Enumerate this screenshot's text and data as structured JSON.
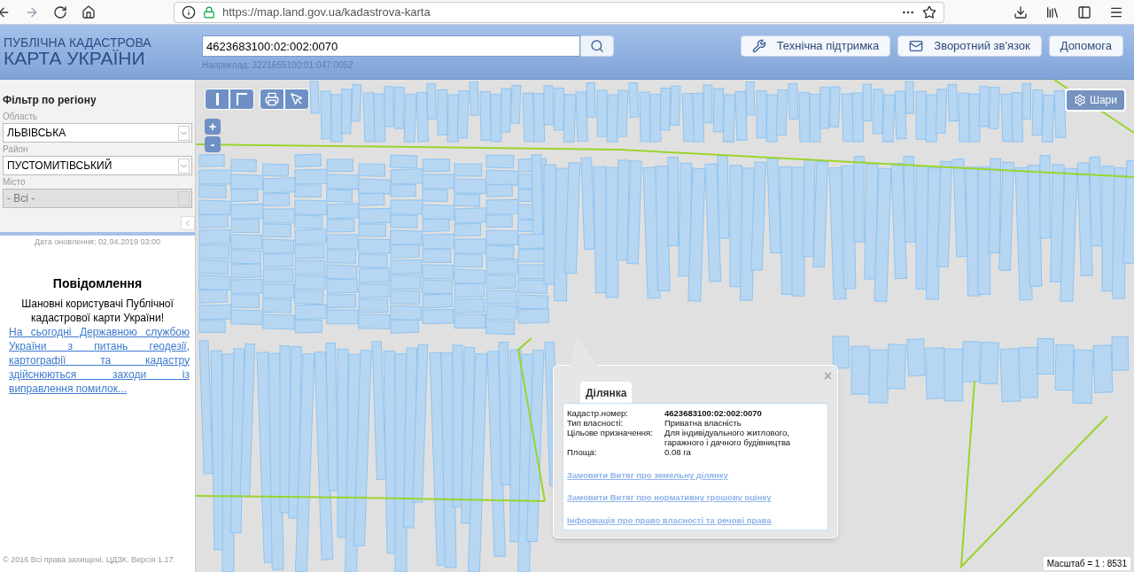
{
  "browser": {
    "url": "https://map.land.gov.ua/kadastrova-karta"
  },
  "header": {
    "logo": [
      "ПУБЛІЧНА КАДАСТРОВА",
      "КАРТА УКРАЇНИ"
    ],
    "search": {
      "value": "4623683100:02:002:0070",
      "hint": "Наприклад: 3221655100:01:047:0052"
    },
    "buttons": [
      {
        "label": "Технічна підтримка",
        "kind": "support"
      },
      {
        "label": "Зворотний зв'язок",
        "kind": "mail"
      },
      {
        "label": "Допомога",
        "kind": "plain"
      }
    ]
  },
  "sidebar": {
    "title": "Фільтр по регіону",
    "filters": [
      {
        "label": "Область",
        "value": "ЛЬВІВСЬКА",
        "disabled": false
      },
      {
        "label": "Район",
        "value": "ПУСТОМИТІВСЬКИЙ",
        "disabled": false
      },
      {
        "label": "Місто",
        "value": "- Всі -",
        "disabled": true
      }
    ],
    "updated": "Дата оновлення: 02.04.2019 03:00",
    "notice": {
      "title": "Повідомлення",
      "greeting": "Шановні користувачі Публічної кадастрової карти України!",
      "link": "На сьогодні Державною службою України з питань геодезії, картографії та кадастру здійснюються заходи із виправлення помилок..."
    },
    "footer": "© 2016 Всі права захищені. ЦДЗК. Версія 1.17."
  },
  "map": {
    "zoom": [
      "+",
      "-"
    ],
    "layers_button": "Шари",
    "popup": {
      "tab": "Ділянка",
      "close": "×",
      "fields": [
        {
          "label": "Кадастр.номер:",
          "value": "4623683100:02:002:0070"
        },
        {
          "label": "Тип власності:",
          "value": "Приватна власність"
        },
        {
          "label": "Цільове призначення:",
          "value": "Для індивідуального житлового, гаражного і дачного будівництва"
        },
        {
          "label": "Площа:",
          "value": "0.08 га"
        }
      ],
      "links": [
        "Замовити Витяг про земельну ділянку",
        "Замовити Витяг про нормативну грошову оцінку",
        "Інформація про право власності та речові права"
      ]
    },
    "scale": "Масштаб = 1 : 8531"
  }
}
